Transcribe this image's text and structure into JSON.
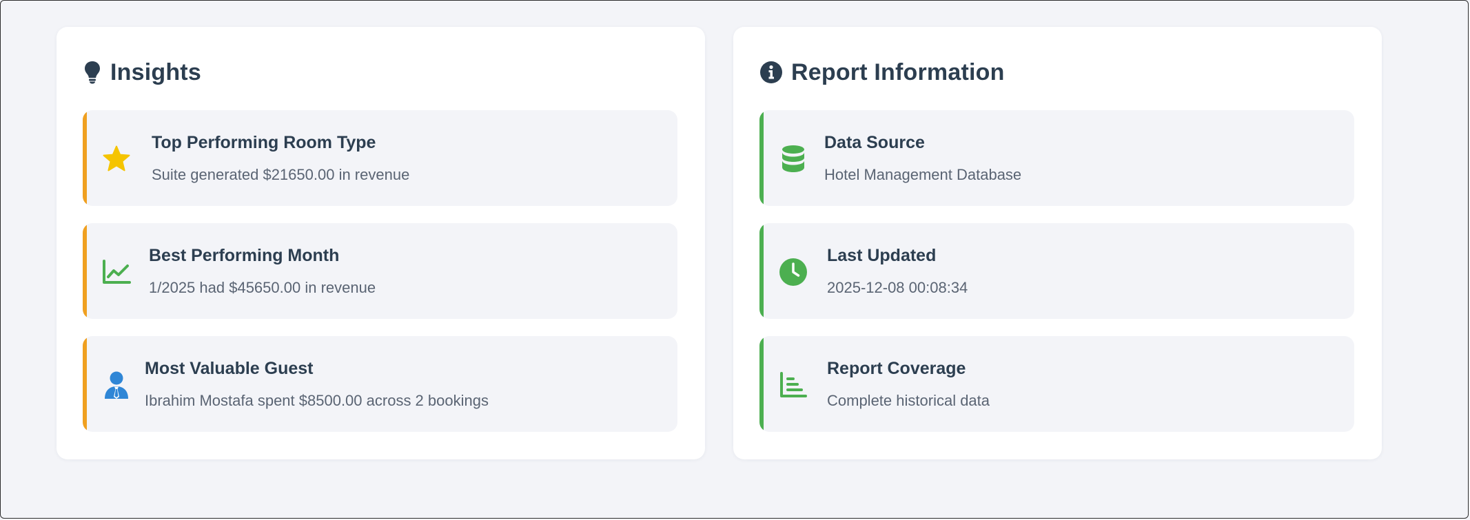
{
  "insights": {
    "title": "Insights",
    "icon": "lightbulb-icon",
    "accent": "#f0a020",
    "cards": [
      {
        "icon": "star-icon",
        "icon_color": "#f5c400",
        "title": "Top Performing Room Type",
        "description": "Suite generated $21650.00 in revenue"
      },
      {
        "icon": "line-chart-icon",
        "icon_color": "#4caf50",
        "title": "Best Performing Month",
        "description": "1/2025 had $45650.00 in revenue"
      },
      {
        "icon": "user-tie-icon",
        "icon_color": "#2f86d6",
        "title": "Most Valuable Guest",
        "description": "Ibrahim Mostafa spent $8500.00 across 2 bookings"
      }
    ]
  },
  "report_info": {
    "title": "Report Information",
    "icon": "info-circle-icon",
    "accent": "#4caf50",
    "cards": [
      {
        "icon": "database-icon",
        "icon_color": "#4caf50",
        "title": "Data Source",
        "description": "Hotel Management Database"
      },
      {
        "icon": "clock-icon",
        "icon_color": "#4caf50",
        "title": "Last Updated",
        "description": "2025-12-08 00:08:34"
      },
      {
        "icon": "bar-chart-icon",
        "icon_color": "#4caf50",
        "title": "Report Coverage",
        "description": "Complete historical data"
      }
    ]
  }
}
